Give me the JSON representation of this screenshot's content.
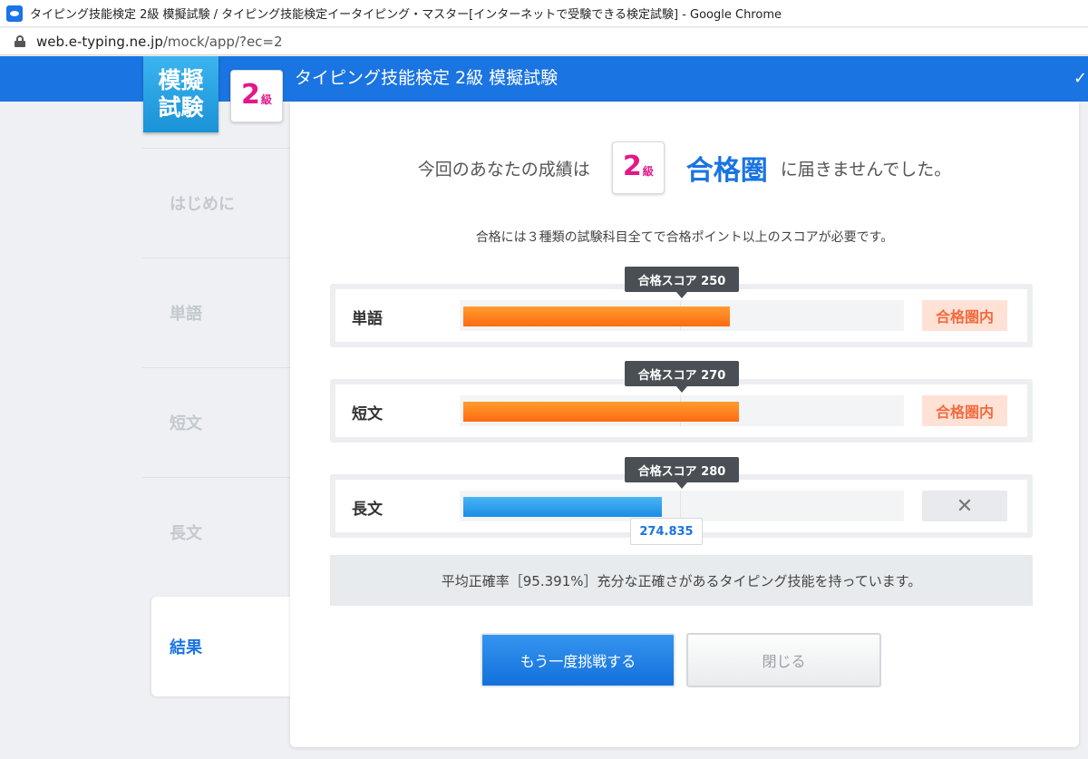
{
  "browser": {
    "window_title": "タイピング技能検定 2級 模擬試験 / タイピング技能検定イータイピング・マスター[インターネットで受験できる検定試験] - Google Chrome",
    "url_host": "web.e-typing.ne.jp",
    "url_path": "/mock/app/?ec=2"
  },
  "header": {
    "logo_line1": "模擬",
    "logo_line2": "試験",
    "grade_num": "2",
    "grade_kyu": "級",
    "title": "タイピング技能検定 2級 模擬試験",
    "check": "✓"
  },
  "sidebar": {
    "items": [
      {
        "label": "はじめに"
      },
      {
        "label": "単語"
      },
      {
        "label": "短文"
      },
      {
        "label": "長文"
      },
      {
        "label": "結果"
      }
    ]
  },
  "result": {
    "prefix": "今回のあなたの成績は",
    "grade_num": "2",
    "grade_kyu": "級",
    "pass_zone": "合格圏",
    "suffix": "に届きませんでした。",
    "requirement": "合格には３種類の試験科目全てで合格ポイント以上のスコアが必要です。"
  },
  "scores": [
    {
      "subject": "単語",
      "pass_score_label": "合格スコア 250",
      "fill_fraction": 0.61,
      "status": "合格圏内"
    },
    {
      "subject": "短文",
      "pass_score_label": "合格スコア 270",
      "fill_fraction": 0.63,
      "status": "合格圏内"
    },
    {
      "subject": "長文",
      "pass_score_label": "合格スコア 280",
      "fill_fraction": 0.455,
      "status": "✕",
      "score_value": "274.835"
    }
  ],
  "accuracy_text": "平均正確率［95.391%］充分な正確さがあるタイピング技能を持っています。",
  "buttons": {
    "retry": "もう一度挑戦する",
    "close": "閉じる"
  },
  "colors": {
    "brand_blue": "#1a74e1",
    "pass_orange": "#ff6a12",
    "pass_badge_text": "#f26b3e",
    "grade_pink": "#e4178a"
  }
}
